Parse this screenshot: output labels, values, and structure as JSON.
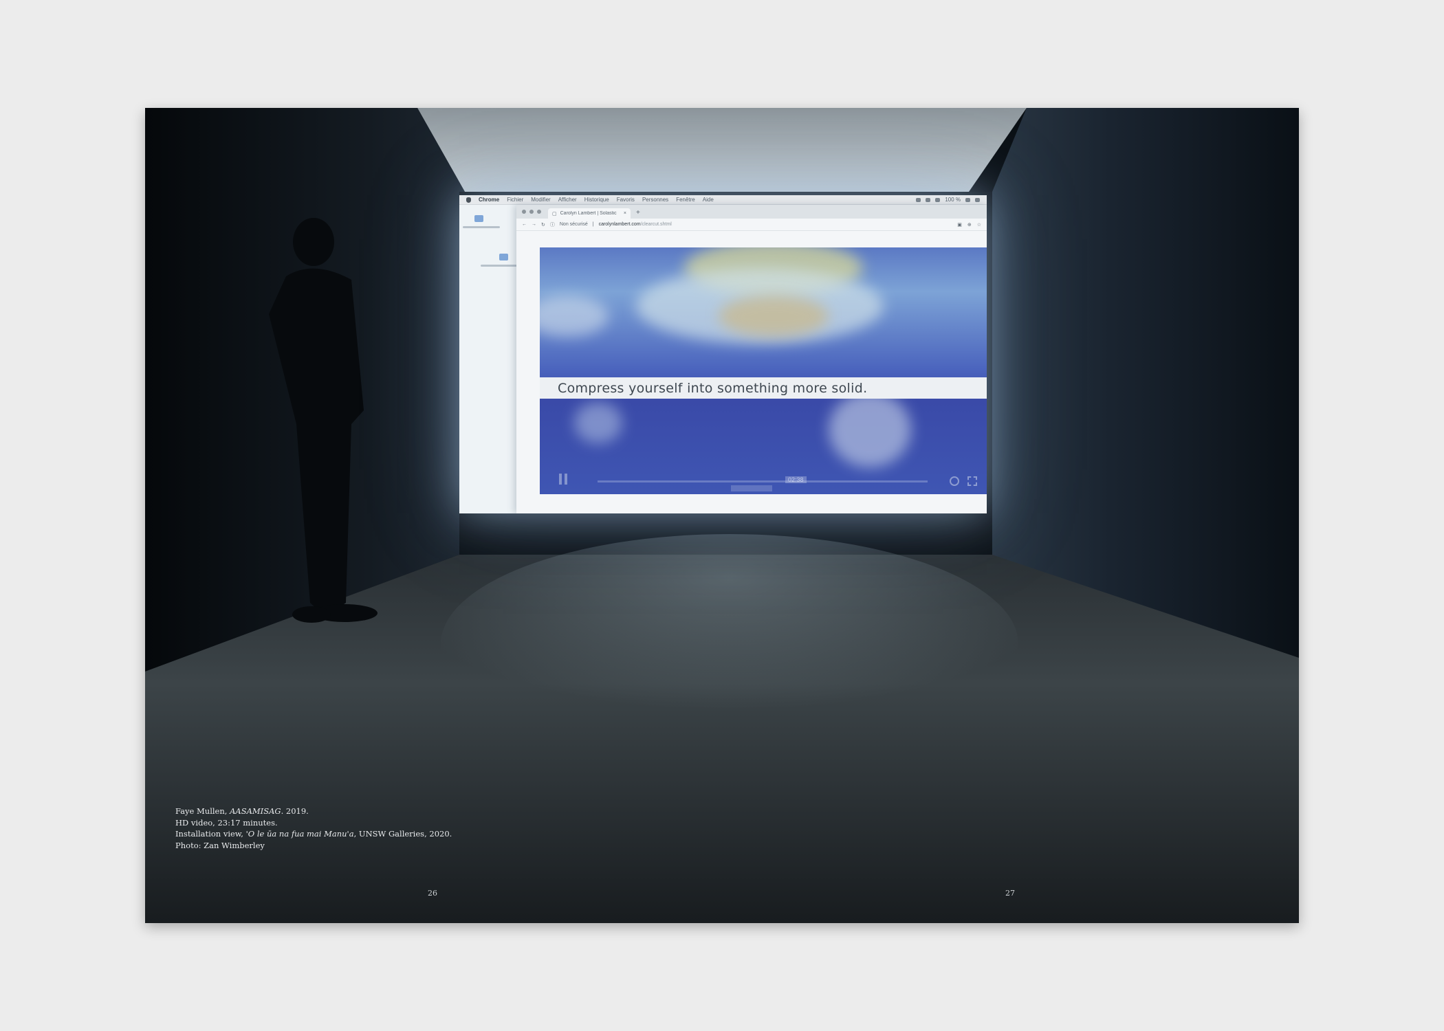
{
  "screen": {
    "menubar": {
      "app_name": "Chrome",
      "items": [
        "Fichier",
        "Modifier",
        "Afficher",
        "Historique",
        "Favoris",
        "Personnes",
        "Fenêtre",
        "Aide"
      ],
      "battery": "100 %"
    },
    "browser": {
      "tab_title": "Carolyn Lambert | Solastic",
      "tab_close": "×",
      "new_tab": "+",
      "security_label": "Non sécurisé",
      "url_domain": "carolynlambert.com",
      "url_path": "/clearcut.shtml"
    },
    "video": {
      "subtitle": "Compress yourself into something more solid.",
      "time": "02:38"
    }
  },
  "caption": {
    "artist": "Faye Mullen, ",
    "title": "AASAMISAG",
    "year": ". 2019.",
    "medium": "HD video, 23:17 minutes.",
    "install_prefix": "Installation view, ",
    "exhibition": "'O le ūa na fua mai Manu'a",
    "install_suffix": ", UNSW Galleries, 2020.",
    "photo_credit": "Photo: Zan Wimberley"
  },
  "pages": {
    "left": "26",
    "right": "27"
  },
  "colors": {
    "page_background": "#ececec",
    "photo_background": "#0a0e12",
    "screen_glow": "#aac8e6",
    "caption_text": "#e8eaec"
  }
}
